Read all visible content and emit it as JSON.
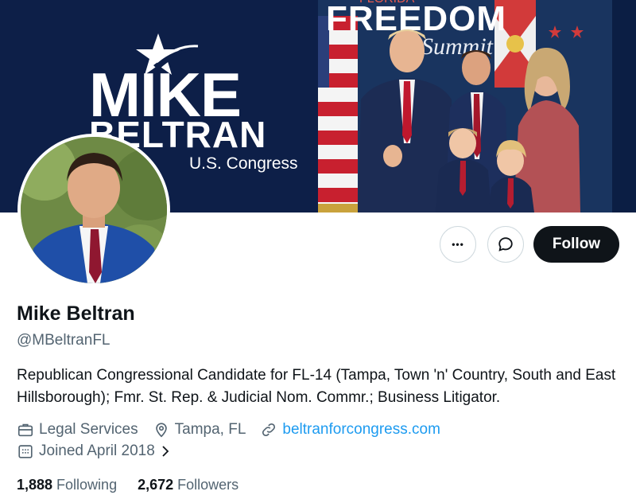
{
  "banner": {
    "name_line1": "MIKE",
    "name_line2": "BELTRAN",
    "subtitle": "U.S. Congress",
    "backdrop_top": "FLORIDA",
    "backdrop_title": "FREEDOM",
    "backdrop_script": "Summit"
  },
  "profile": {
    "display_name": "Mike Beltran",
    "handle": "@MBeltranFL",
    "bio": "Republican Congressional Candidate for FL-14 (Tampa, Town 'n' Country, South and East Hillsborough); Fmr. St. Rep. & Judicial Nom. Commr.; Business Litigator.",
    "category": "Legal Services",
    "location": "Tampa, FL",
    "website": "beltranforcongress.com",
    "joined": "Joined April 2018",
    "following_count": "1,888",
    "following_label": "Following",
    "followers_count": "2,672",
    "followers_label": "Followers"
  },
  "actions": {
    "more_label": "•••",
    "follow_label": "Follow"
  },
  "colors": {
    "accent": "#1d9bf0",
    "follow_bg": "#0f1419",
    "secondary_text": "#536471"
  },
  "icons": [
    "more-icon",
    "message-icon",
    "briefcase-icon",
    "location-pin-icon",
    "link-icon",
    "calendar-icon",
    "chevron-right-icon"
  ]
}
